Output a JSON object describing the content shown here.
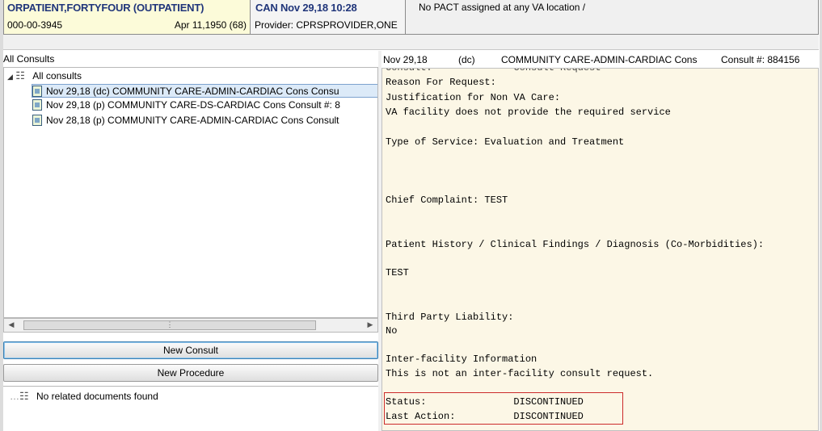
{
  "patient": {
    "name": "ORPATIENT,FORTYFOUR (OUTPATIENT)",
    "ssn": "000-00-3945",
    "dob_age": "Apr 11,1950 (68)"
  },
  "encounter": {
    "location_date": "CAN Nov 29,18 10:28",
    "provider": "Provider:  CPRSPROVIDER,ONE"
  },
  "pact": "No PACT assigned at any VA location /",
  "left_pane": {
    "label": "All Consults",
    "tree_root": "All consults",
    "items": [
      {
        "text": "Nov 29,18  (dc)  COMMUNITY CARE-ADMIN-CARDIAC Cons Consu",
        "selected": true
      },
      {
        "text": "Nov 29,18  (p)  COMMUNITY CARE-DS-CARDIAC Cons Consult #: 8",
        "selected": false
      },
      {
        "text": "Nov 28,18  (p)  COMMUNITY CARE-ADMIN-CARDIAC Cons Consult",
        "selected": false
      }
    ],
    "new_consult": "New Consult",
    "new_procedure": "New Procedure",
    "related_docs": "No related documents found"
  },
  "detail_header": {
    "date": "Nov 29,18",
    "status": "(dc)",
    "title": "COMMUNITY CARE-ADMIN-CARDIAC Cons",
    "consult_no": "Consult #: 884156"
  },
  "detail": {
    "cut_line": "Consult:              Consult Request",
    "reason": "Reason For Request:",
    "justification": "Justification for Non VA Care:",
    "justification_value": "VA facility does not provide the required service",
    "service": "Type of Service: Evaluation and Treatment",
    "complaint": "Chief Complaint: TEST",
    "history": "Patient History / Clinical Findings / Diagnosis (Co-Morbidities):",
    "history_value": "TEST",
    "liability": "Third Party Liability:",
    "liability_value": "No",
    "interfacility": "Inter-facility Information",
    "interfacility_value": "This is not an inter-facility consult request.",
    "status_line": "Status:               DISCONTINUED",
    "last_action_line": "Last Action:          DISCONTINUED"
  }
}
